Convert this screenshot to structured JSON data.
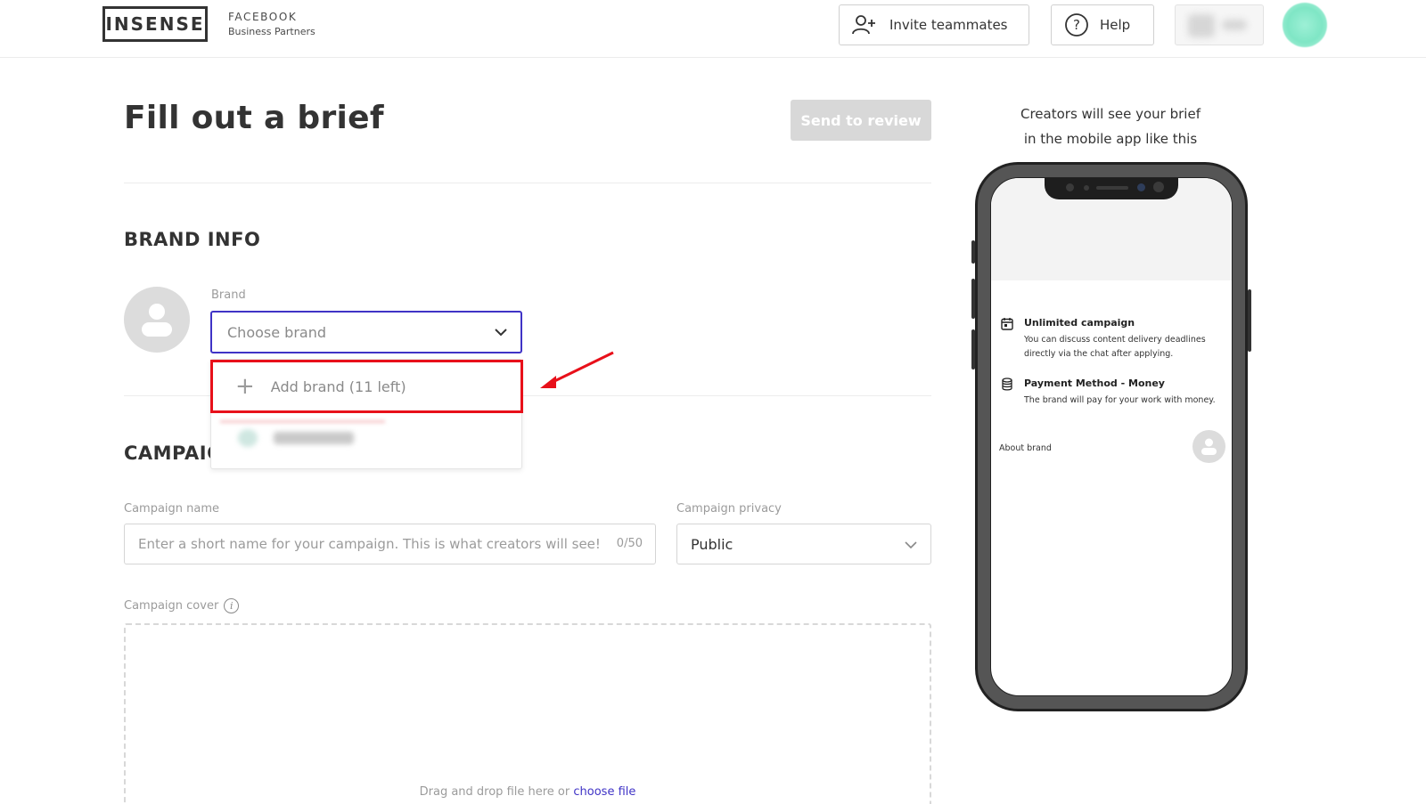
{
  "header": {
    "logo_text": "INSENSE",
    "partner_line1": "FACEBOOK",
    "partner_line2": "Business Partners",
    "invite_label": "Invite teammates",
    "help_label": "Help"
  },
  "page": {
    "title": "Fill out a brief",
    "send_label": "Send to review"
  },
  "brand_info": {
    "section_title": "BRAND INFO",
    "brand_label": "Brand",
    "brand_placeholder": "Choose brand",
    "add_brand_label": "Add brand (11 left)"
  },
  "campaign": {
    "section_title": "CAMPAIGN",
    "name_label": "Campaign name",
    "name_placeholder": "Enter a short name for your campaign. This is what creators will see!",
    "name_counter": "0/50",
    "privacy_label": "Campaign privacy",
    "privacy_value": "Public",
    "cover_label": "Campaign cover",
    "dropzone_text": "Drag and drop file here or",
    "dropzone_link": "choose file"
  },
  "preview": {
    "caption_line1": "Creators will see your brief",
    "caption_line2": "in the mobile app like this",
    "items": [
      {
        "title": "Unlimited campaign",
        "desc": "You can discuss content delivery deadlines directly via the chat after applying.",
        "icon": "calendar-icon"
      },
      {
        "title": "Payment Method - Money",
        "desc": "The brand will pay for your work with money.",
        "icon": "coins-icon"
      }
    ],
    "about_brand": "About brand"
  },
  "colors": {
    "accent": "#3f33c6",
    "highlight_red": "#e8101a",
    "disabled_button": "#d8d8d8"
  }
}
